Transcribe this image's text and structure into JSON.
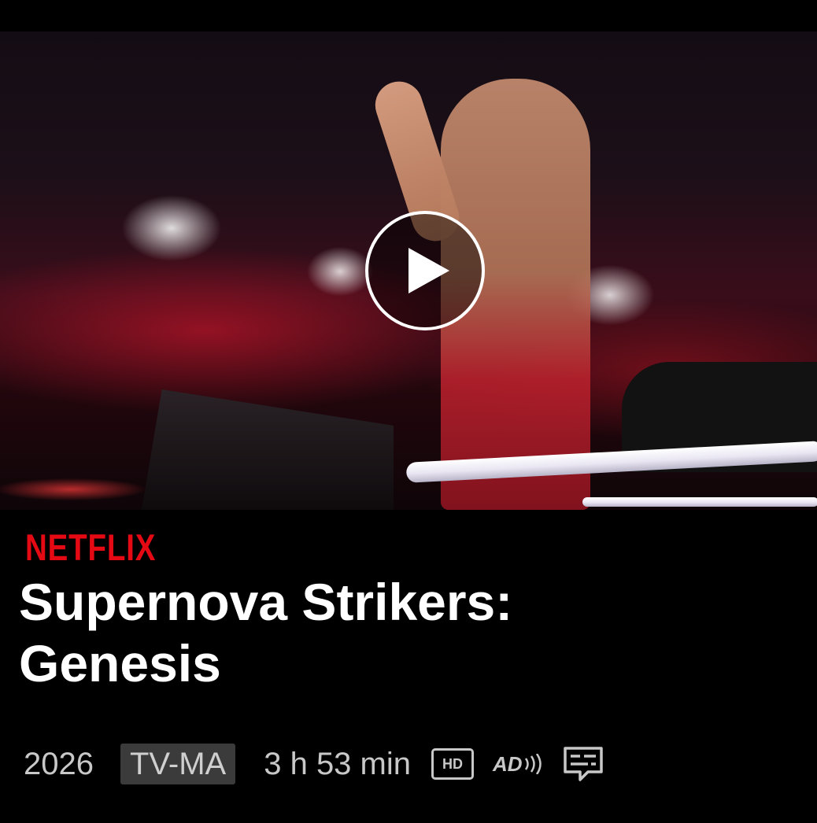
{
  "hero": {
    "play_icon": "play-icon"
  },
  "brand": {
    "logo_text": "NETFLIX",
    "color": "#e50914"
  },
  "title": {
    "line1": "Supernova Strikers:",
    "line2": "Genesis"
  },
  "meta": {
    "year": "2026",
    "rating": "TV-MA",
    "duration": "3 h 53 min",
    "hd_label": "HD",
    "ad_label": "AD",
    "subtitles_icon": "subtitles-icon"
  }
}
